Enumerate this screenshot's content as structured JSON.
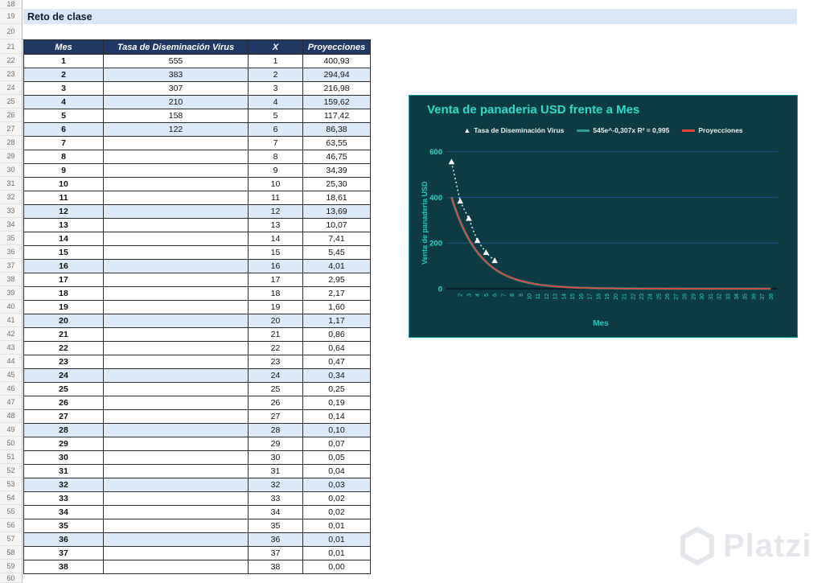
{
  "spreadsheet": {
    "title": "Reto de clase",
    "row_start": 18,
    "row_end": 60,
    "table": {
      "headers": [
        "Mes",
        "Tasa de Diseminación Virus",
        "X",
        "Proyecciones"
      ],
      "rows": [
        {
          "mes": "1",
          "tasa": "555",
          "x": "1",
          "proy": "400,93",
          "shaded": false
        },
        {
          "mes": "2",
          "tasa": "383",
          "x": "2",
          "proy": "294,94",
          "shaded": true
        },
        {
          "mes": "3",
          "tasa": "307",
          "x": "3",
          "proy": "216,98",
          "shaded": false
        },
        {
          "mes": "4",
          "tasa": "210",
          "x": "4",
          "proy": "159,62",
          "shaded": true
        },
        {
          "mes": "5",
          "tasa": "158",
          "x": "5",
          "proy": "117,42",
          "shaded": false
        },
        {
          "mes": "6",
          "tasa": "122",
          "x": "6",
          "proy": "86,38",
          "shaded": true
        },
        {
          "mes": "7",
          "tasa": "",
          "x": "7",
          "proy": "63,55",
          "shaded": false
        },
        {
          "mes": "8",
          "tasa": "",
          "x": "8",
          "proy": "46,75",
          "shaded": false
        },
        {
          "mes": "9",
          "tasa": "",
          "x": "9",
          "proy": "34,39",
          "shaded": false
        },
        {
          "mes": "10",
          "tasa": "",
          "x": "10",
          "proy": "25,30",
          "shaded": false
        },
        {
          "mes": "11",
          "tasa": "",
          "x": "11",
          "proy": "18,61",
          "shaded": false
        },
        {
          "mes": "12",
          "tasa": "",
          "x": "12",
          "proy": "13,69",
          "shaded": true
        },
        {
          "mes": "13",
          "tasa": "",
          "x": "13",
          "proy": "10,07",
          "shaded": false
        },
        {
          "mes": "14",
          "tasa": "",
          "x": "14",
          "proy": "7,41",
          "shaded": false
        },
        {
          "mes": "15",
          "tasa": "",
          "x": "15",
          "proy": "5,45",
          "shaded": false
        },
        {
          "mes": "16",
          "tasa": "",
          "x": "16",
          "proy": "4,01",
          "shaded": true
        },
        {
          "mes": "17",
          "tasa": "",
          "x": "17",
          "proy": "2,95",
          "shaded": false
        },
        {
          "mes": "18",
          "tasa": "",
          "x": "18",
          "proy": "2,17",
          "shaded": false
        },
        {
          "mes": "19",
          "tasa": "",
          "x": "19",
          "proy": "1,60",
          "shaded": false
        },
        {
          "mes": "20",
          "tasa": "",
          "x": "20",
          "proy": "1,17",
          "shaded": true
        },
        {
          "mes": "21",
          "tasa": "",
          "x": "21",
          "proy": "0,86",
          "shaded": false
        },
        {
          "mes": "22",
          "tasa": "",
          "x": "22",
          "proy": "0,64",
          "shaded": false
        },
        {
          "mes": "23",
          "tasa": "",
          "x": "23",
          "proy": "0,47",
          "shaded": false
        },
        {
          "mes": "24",
          "tasa": "",
          "x": "24",
          "proy": "0,34",
          "shaded": true
        },
        {
          "mes": "25",
          "tasa": "",
          "x": "25",
          "proy": "0,25",
          "shaded": false
        },
        {
          "mes": "26",
          "tasa": "",
          "x": "26",
          "proy": "0,19",
          "shaded": false
        },
        {
          "mes": "27",
          "tasa": "",
          "x": "27",
          "proy": "0,14",
          "shaded": false
        },
        {
          "mes": "28",
          "tasa": "",
          "x": "28",
          "proy": "0,10",
          "shaded": true
        },
        {
          "mes": "29",
          "tasa": "",
          "x": "29",
          "proy": "0,07",
          "shaded": false
        },
        {
          "mes": "30",
          "tasa": "",
          "x": "30",
          "proy": "0,05",
          "shaded": false
        },
        {
          "mes": "31",
          "tasa": "",
          "x": "31",
          "proy": "0,04",
          "shaded": false
        },
        {
          "mes": "32",
          "tasa": "",
          "x": "32",
          "proy": "0,03",
          "shaded": true
        },
        {
          "mes": "33",
          "tasa": "",
          "x": "33",
          "proy": "0,02",
          "shaded": false
        },
        {
          "mes": "34",
          "tasa": "",
          "x": "34",
          "proy": "0,02",
          "shaded": false
        },
        {
          "mes": "35",
          "tasa": "",
          "x": "35",
          "proy": "0,01",
          "shaded": false
        },
        {
          "mes": "36",
          "tasa": "",
          "x": "36",
          "proy": "0,01",
          "shaded": true
        },
        {
          "mes": "37",
          "tasa": "",
          "x": "37",
          "proy": "0,01",
          "shaded": false
        },
        {
          "mes": "38",
          "tasa": "",
          "x": "38",
          "proy": "0,00",
          "shaded": false
        }
      ]
    }
  },
  "chart_data": {
    "type": "scatter",
    "title": "Venta de panaderia USD frente a Mes",
    "xlabel": "Mes",
    "ylabel": "Venta de panaderia USD",
    "ylim": [
      0,
      600
    ],
    "y_ticks": [
      0,
      200,
      400,
      600
    ],
    "x_tick_range": [
      2,
      38
    ],
    "grid": true,
    "legend_position": "top",
    "legend": [
      "Tasa de Diseminación Virus",
      "545e^-0,307x  R² = 0,995",
      "Proyecciones"
    ],
    "colors": {
      "background": "#0d3b44",
      "border": "#11929b",
      "title": "#25dcc5",
      "axis_text": "#2fd3c6",
      "grid": "#1c4e8c",
      "axis_line": "#071e29"
    },
    "series": [
      {
        "name": "Tasa de Diseminación Virus",
        "type": "scatter",
        "marker": "triangle",
        "marker_color": "#ffffff",
        "line_color": "#d8f4f1",
        "line_style": "dotted",
        "x": [
          1,
          2,
          3,
          4,
          5,
          6
        ],
        "y": [
          555,
          383,
          307,
          210,
          158,
          122
        ]
      },
      {
        "name": "545e^-0,307x  R² = 0,995",
        "type": "line",
        "color": "#2d9e94",
        "formula": "y = 545 * exp(-0.307 * x)",
        "a": 545,
        "b": -0.307,
        "x_range": [
          1,
          38
        ]
      },
      {
        "name": "Proyecciones",
        "type": "line",
        "color": "#e64437",
        "x_start": 1,
        "x_step": 1,
        "values": [
          400.93,
          294.94,
          216.98,
          159.62,
          117.42,
          86.38,
          63.55,
          46.75,
          34.39,
          25.3,
          18.61,
          13.69,
          10.07,
          7.41,
          5.45,
          4.01,
          2.95,
          2.17,
          1.6,
          1.17,
          0.86,
          0.64,
          0.47,
          0.34,
          0.25,
          0.19,
          0.14,
          0.1,
          0.07,
          0.05,
          0.04,
          0.03,
          0.02,
          0.02,
          0.01,
          0.01,
          0.01,
          0.0
        ]
      }
    ]
  },
  "watermark": {
    "text": "Platzi"
  }
}
